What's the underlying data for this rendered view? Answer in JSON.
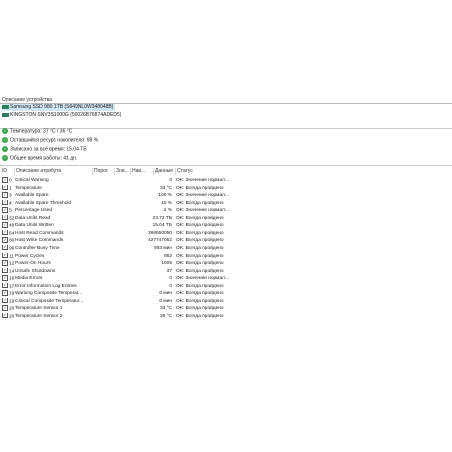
{
  "devices": {
    "header": "Описание устройства",
    "items": [
      {
        "label": "Samsung SSD 980 1TB (S649NL0W348048B)",
        "selected": true
      },
      {
        "label": "KINGSTON SNV3S1000G (50026B76874ADED5)",
        "selected": false
      }
    ]
  },
  "summary": [
    {
      "text": "Температура: 37 °C / 36 °C"
    },
    {
      "text": "Оставшийся ресурс накопителя: 98 %"
    },
    {
      "text": "Записано за всё время: 15.04 ТБ"
    },
    {
      "text": "Общее время работы: 41 дн."
    }
  ],
  "columns": {
    "id": "ID",
    "desc": "Описание атрибута",
    "threshold": "Порог",
    "value": "Зна...",
    "worst": "Наи...",
    "data": "Данные",
    "status": "Статус"
  },
  "attributes": [
    {
      "id": "0",
      "desc": "Critical Warning",
      "data": "0",
      "status": "OK: Значение нормал..."
    },
    {
      "id": "1",
      "desc": "Temperature",
      "data": "33 °C",
      "status": "OK: Всегда пройдено"
    },
    {
      "id": "3",
      "desc": "Available Spare",
      "data": "100 %",
      "status": "OK: Значение нормал..."
    },
    {
      "id": "4",
      "desc": "Available Spare Threshold",
      "data": "10 %",
      "status": "OK: Всегда пройдено"
    },
    {
      "id": "5",
      "desc": "Percentage Used",
      "data": "2 %",
      "status": "OK: Значение нормал..."
    },
    {
      "id": "32",
      "desc": "Data Units Read",
      "data": "23.72 ТБ",
      "status": "OK: Всегда пройдено"
    },
    {
      "id": "48",
      "desc": "Data Units Written",
      "data": "15.04 ТБ",
      "status": "OK: Всегда пройдено"
    },
    {
      "id": "64",
      "desc": "Host Read Commands",
      "data": "398650050",
      "status": "OK: Всегда пройдено"
    },
    {
      "id": "80",
      "desc": "Host Write Commands",
      "data": "427747052",
      "status": "OK: Всегда пройдено"
    },
    {
      "id": "96",
      "desc": "Controller Busy Time",
      "data": "993 мин",
      "status": "OK: Всегда пройдено"
    },
    {
      "id": "112",
      "desc": "Power Cycles",
      "data": "952",
      "status": "OK: Всегда пройдено"
    },
    {
      "id": "128",
      "desc": "Power-On Hours",
      "data": "1005",
      "status": "OK: Всегда пройдено"
    },
    {
      "id": "144",
      "desc": "Unsafe Shutdowns",
      "data": "37",
      "status": "OK: Всегда пройдено"
    },
    {
      "id": "160",
      "desc": "Media Errors",
      "data": "0",
      "status": "OK: Значение нормал..."
    },
    {
      "id": "176",
      "desc": "Error Information Log Entries",
      "data": "0",
      "status": "OK: Всегда пройдено"
    },
    {
      "id": "192",
      "desc": "Warning Composite Temperat...",
      "data": "0 мин",
      "status": "OK: Всегда пройдено"
    },
    {
      "id": "196",
      "desc": "Critical Composite Temperatur...",
      "data": "0 мин",
      "status": "OK: Всегда пройдено"
    },
    {
      "id": "200",
      "desc": "Temperature Sensor 1",
      "data": "33 °C",
      "status": "OK: Всегда пройдено"
    },
    {
      "id": "202",
      "desc": "Temperature Sensor 2",
      "data": "36 °C",
      "status": "OK: Всегда пройдено"
    }
  ],
  "colors": {
    "ok_green": "#3aa545",
    "device_icon": "#2e7d5b",
    "selection": "#cfe6f7"
  },
  "icons": {
    "summary": "ok-check-icon",
    "device": "drive-icon",
    "row": "checkbox-icon"
  }
}
